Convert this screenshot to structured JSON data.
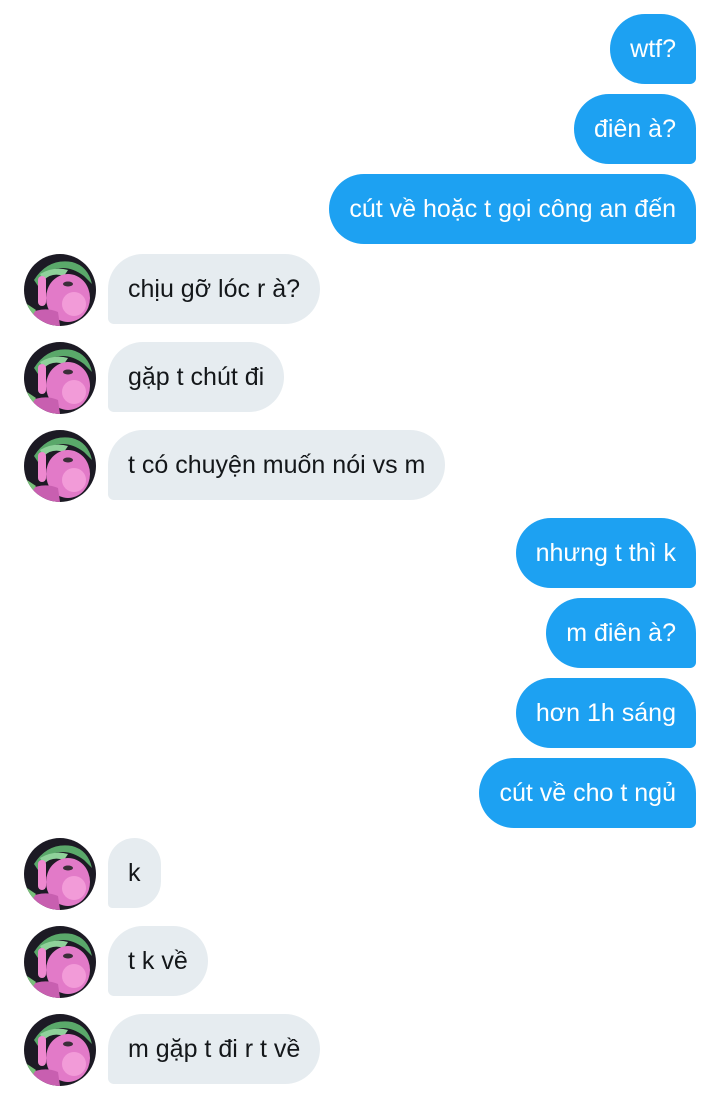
{
  "messages": [
    {
      "dir": "out",
      "text": "wtf?"
    },
    {
      "dir": "out",
      "text": "điên à?"
    },
    {
      "dir": "out",
      "text": "cút về hoặc t gọi công an đến"
    },
    {
      "dir": "in",
      "text": "chịu gỡ lóc r à?"
    },
    {
      "dir": "in",
      "text": "gặp t chút đi"
    },
    {
      "dir": "in",
      "text": "t có chuyện muốn nói vs m"
    },
    {
      "dir": "out",
      "text": "nhưng t thì k"
    },
    {
      "dir": "out",
      "text": "m điên à?"
    },
    {
      "dir": "out",
      "text": "hơn 1h sáng"
    },
    {
      "dir": "out",
      "text": "cút về cho t ngủ"
    },
    {
      "dir": "in",
      "text": "k"
    },
    {
      "dir": "in",
      "text": "t k về"
    },
    {
      "dir": "in",
      "text": "m gặp t đi r t về"
    }
  ],
  "colors": {
    "outgoing_bubble": "#1da1f2",
    "incoming_bubble": "#e6ecf0",
    "outgoing_text": "#ffffff",
    "incoming_text": "#14171a"
  },
  "avatar_icon": "profile-photo-icon"
}
